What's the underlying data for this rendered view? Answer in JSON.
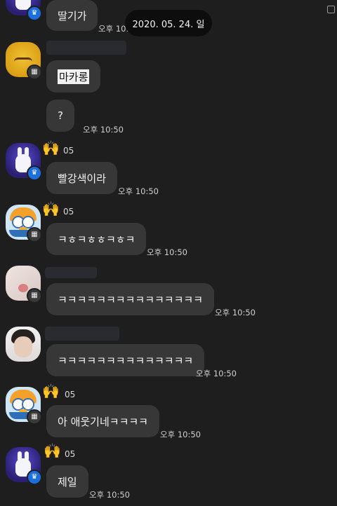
{
  "date_divider": "2020. 05. 24. 일",
  "messages": [
    {
      "text": "딸기가",
      "time": "오후 10:50"
    },
    {
      "text": "마카롱",
      "time": ""
    },
    {
      "text": "?",
      "time": "오후 10:50"
    },
    {
      "text": "빨강색이라",
      "time": "오후 10:50"
    },
    {
      "text": "ㅋㅎㅋㅎㅎㅋㅎㅋ",
      "time": "오후 10:50"
    },
    {
      "text": "ㅋㅋㅋㅋㅋㅋㅋㅋㅋㅋㅋㅋㅋㅋㅋ",
      "time": "오후 10:50"
    },
    {
      "text": "ㅋㅋㅋㅋㅋㅋㅋㅋㅋㅋㅋㅋㅋㅋ",
      "time": "오후 10:50"
    },
    {
      "text": "아 애웃기네ㅋㅋㅋㅋ",
      "time": "오후 10:50"
    },
    {
      "text": "제일",
      "time": "오후 10:50"
    }
  ],
  "sender_names": [
    "05",
    "05",
    "05",
    "05"
  ],
  "icons": {
    "crown_badge": "crown-icon",
    "grid_badge": "grid-icon",
    "hands": "raised-hands-icon",
    "scroll": "square-icon"
  },
  "colors": {
    "background": "#1e1e1e",
    "bubble": "#373737",
    "badge_crown": "#1d6fe0"
  }
}
